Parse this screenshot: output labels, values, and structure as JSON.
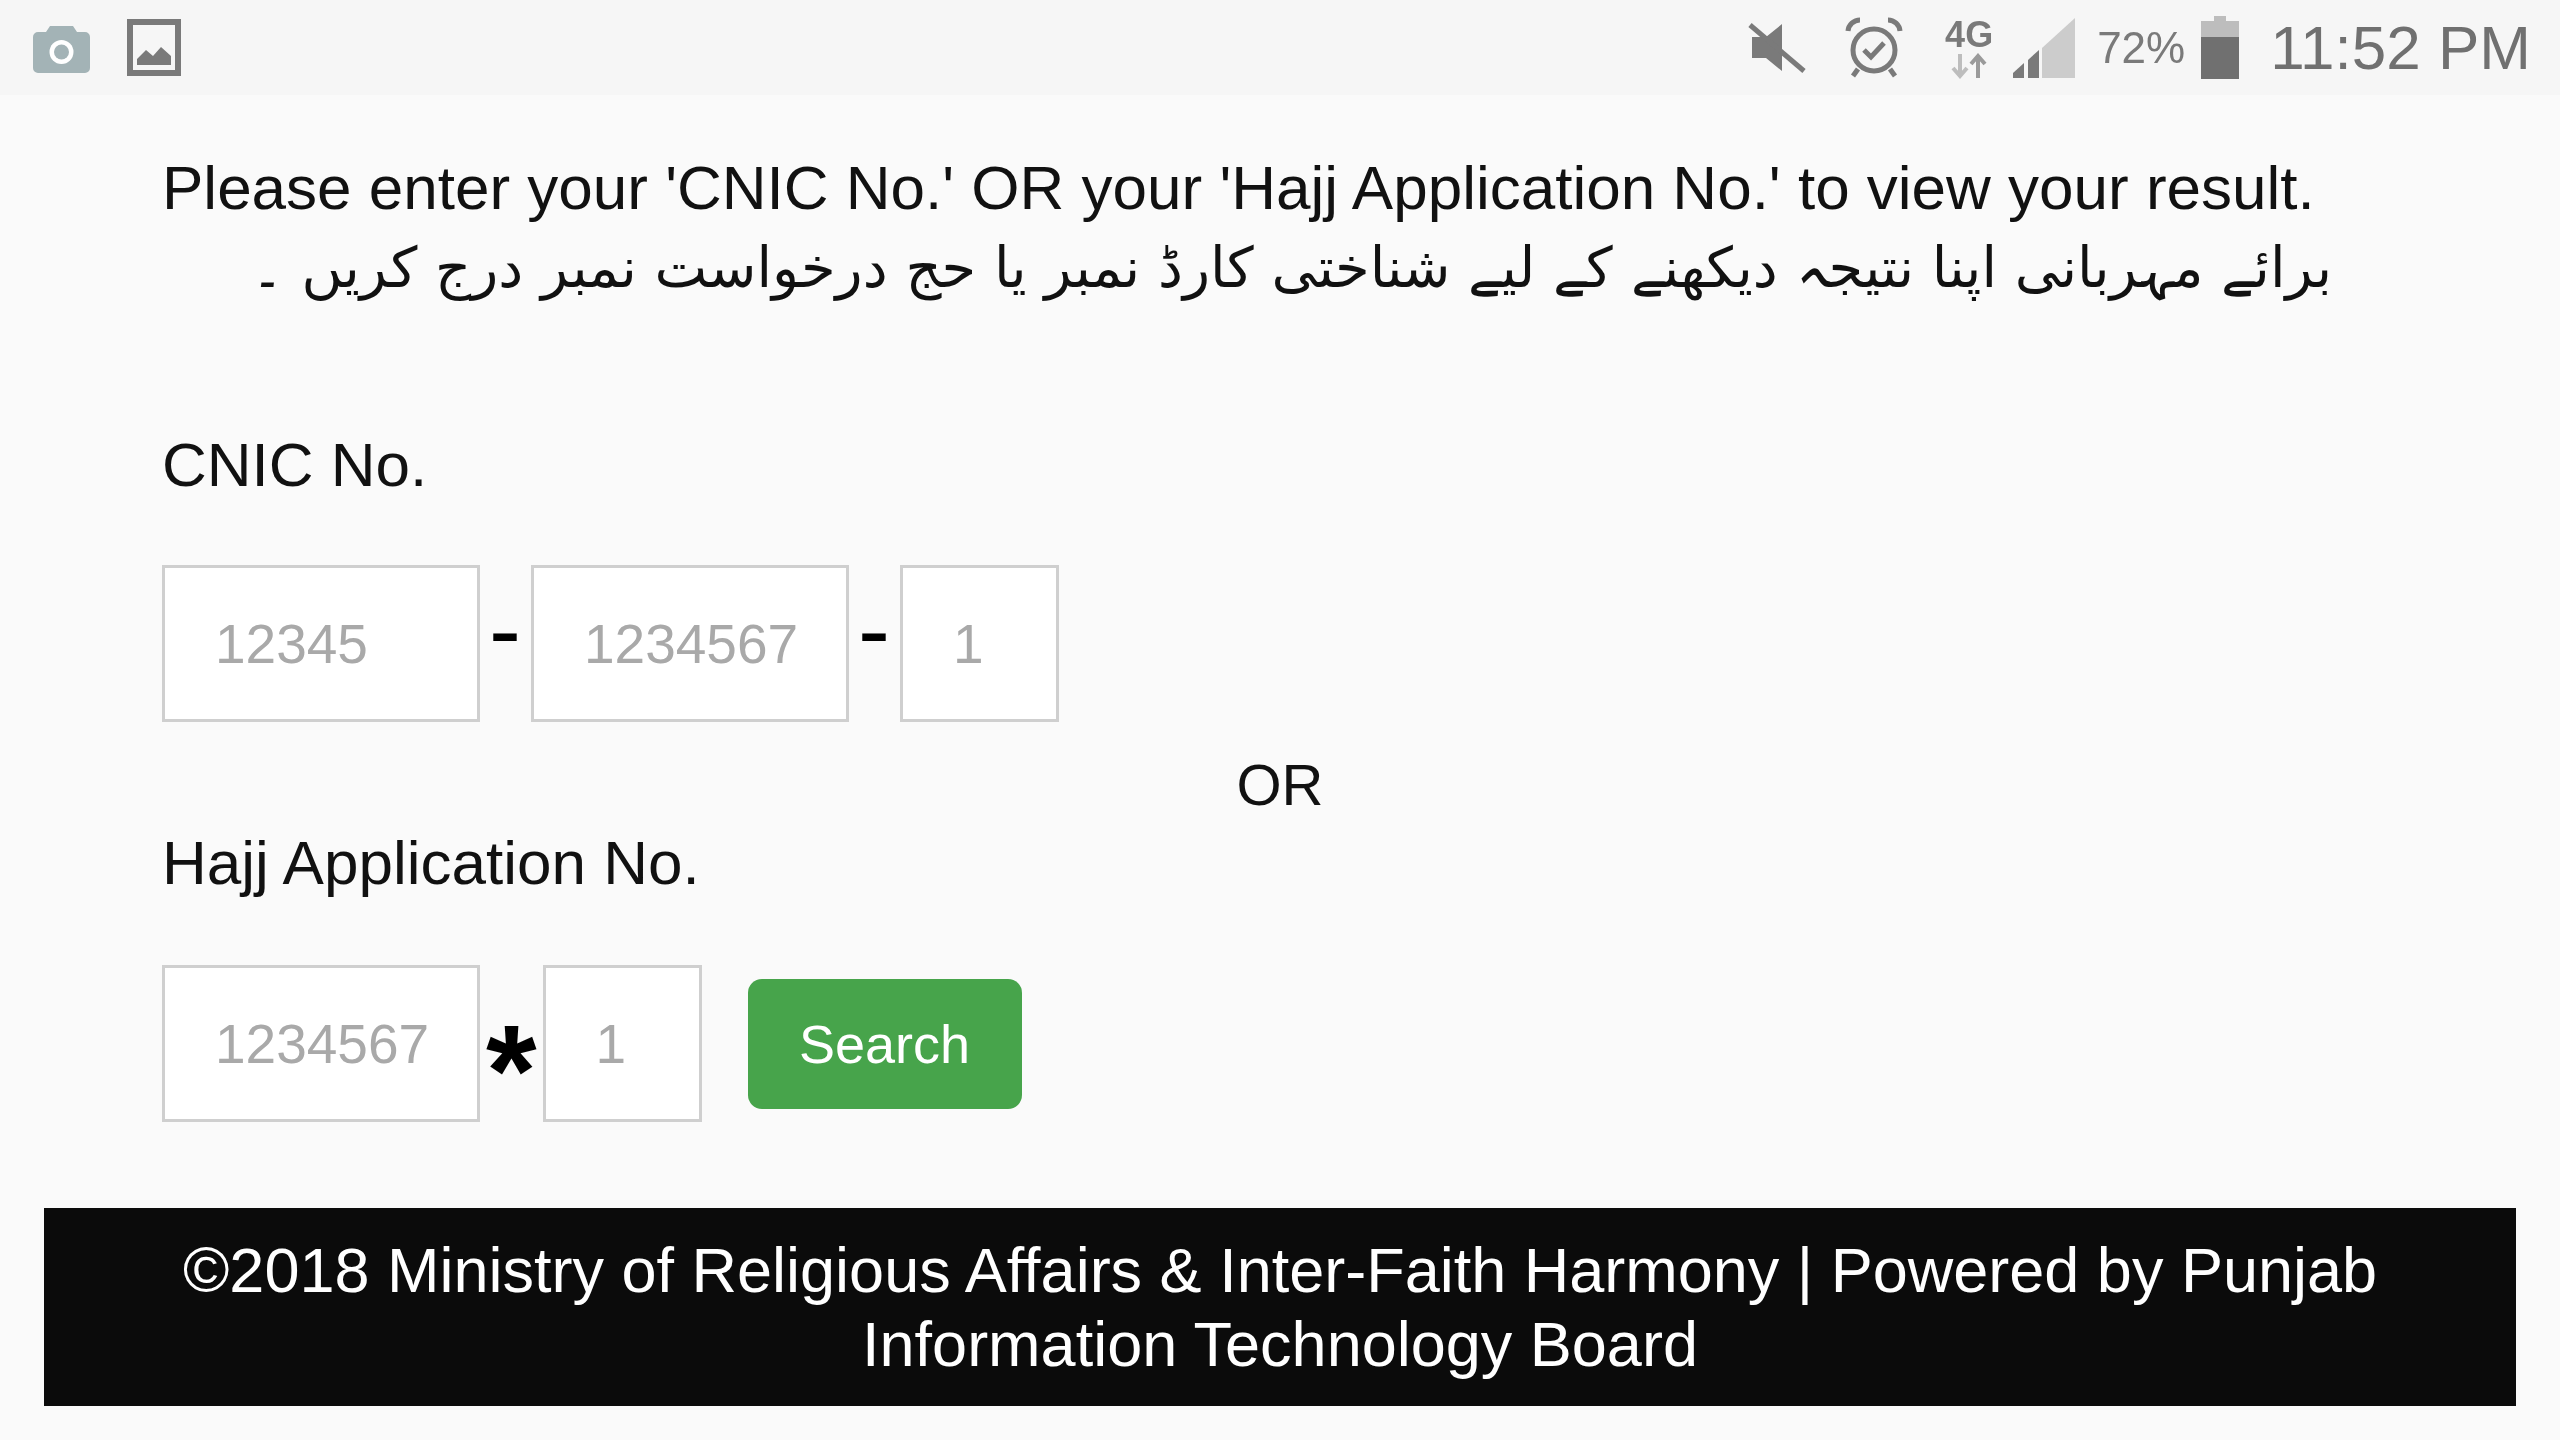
{
  "status_bar": {
    "network": "4G",
    "battery": "72%",
    "time": "11:52 PM"
  },
  "instructions": {
    "english": "Please enter your 'CNIC No.' OR your 'Hajj Application No.' to view your result.",
    "urdu": "برائے مہربانی اپنا نتیجہ دیکھنے کے لیے شناختی کارڈ نمبر یا حج درخواست نمبر درج کریں ۔"
  },
  "cnic": {
    "label": "CNIC No.",
    "fields": [
      {
        "placeholder": "12345"
      },
      {
        "placeholder": "1234567"
      },
      {
        "placeholder": "1"
      }
    ],
    "separators": [
      "-",
      "-"
    ]
  },
  "divider": {
    "text": "OR"
  },
  "hajj": {
    "label": "Hajj Application No.",
    "fields": [
      {
        "placeholder": "1234567"
      },
      {
        "placeholder": "1"
      }
    ],
    "separator": "*",
    "button": "Search"
  },
  "footer": {
    "text": "©2018 Ministry of Religious Affairs & Inter-Faith Harmony | Powered by Punjab Information Technology Board"
  }
}
